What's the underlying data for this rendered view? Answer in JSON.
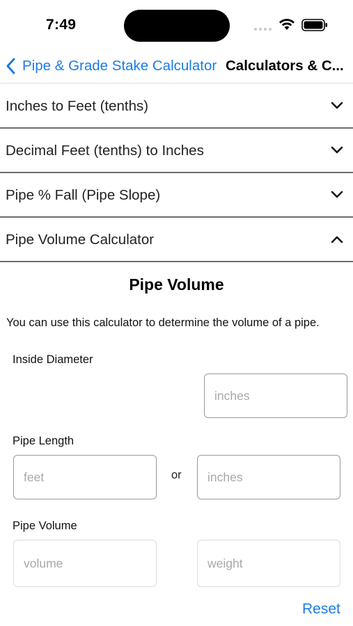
{
  "status_bar": {
    "time": "7:49",
    "icons": [
      "signal-icon",
      "wifi-icon",
      "battery-icon"
    ]
  },
  "nav": {
    "back_label": "Pipe & Grade Stake Calculator",
    "title": "Calculators & C..."
  },
  "accordion": [
    {
      "label": "Inches to Feet (tenths)",
      "expanded": false
    },
    {
      "label": "Decimal Feet (tenths) to Inches",
      "expanded": false
    },
    {
      "label": "Pipe % Fall (Pipe Slope)",
      "expanded": false
    },
    {
      "label": "Pipe Volume Calculator",
      "expanded": true
    }
  ],
  "calculator": {
    "title": "Pipe Volume",
    "description": "You can use this calculator to determine the volume of a pipe.",
    "inside_diameter": {
      "label": "Inside Diameter",
      "inches_placeholder": "inches",
      "inches_value": ""
    },
    "pipe_length": {
      "label": "Pipe Length",
      "feet_placeholder": "feet",
      "feet_value": "",
      "or_text": "or",
      "inches_placeholder": "inches",
      "inches_value": ""
    },
    "pipe_volume": {
      "label": "Pipe Volume",
      "volume_placeholder": "volume",
      "volume_value": "",
      "weight_placeholder": "weight",
      "weight_value": ""
    },
    "reset_label": "Reset"
  },
  "colors": {
    "accent": "#1b7ce6",
    "divider": "#6d6d6d",
    "input_border": "#9a9a9a",
    "placeholder": "#a8a8a8"
  }
}
